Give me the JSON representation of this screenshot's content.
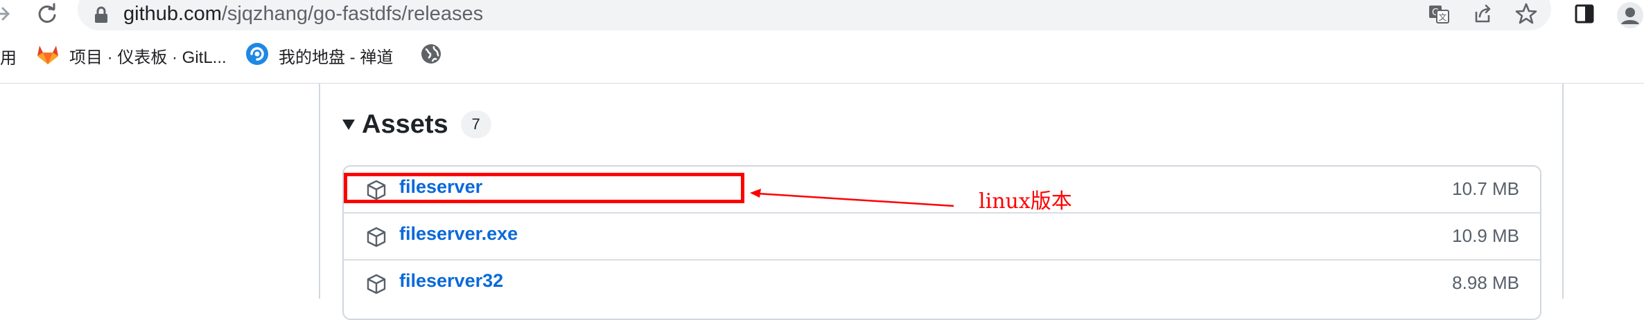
{
  "browser": {
    "url_host": "github.com",
    "url_path": "/sjqzhang/go-fastdfs/releases",
    "bookmarks": {
      "apps_label": "用",
      "items": [
        {
          "label": "项目 · 仪表板 · GitL...",
          "icon": "gitlab-icon"
        },
        {
          "label": "我的地盘 - 禅道",
          "icon": "zentao-icon"
        },
        {
          "label": "",
          "icon": "globe-icon"
        }
      ]
    },
    "icons": [
      "forward-icon",
      "reload-icon",
      "lock-icon",
      "translate-icon",
      "share-icon",
      "star-icon",
      "sidepanel-icon",
      "profile-icon"
    ]
  },
  "assets": {
    "title": "Assets",
    "count": "7",
    "rows": [
      {
        "name": "fileserver",
        "size": "10.7 MB"
      },
      {
        "name": "fileserver.exe",
        "size": "10.9 MB"
      },
      {
        "name": "fileserver32",
        "size": "8.98 MB"
      }
    ]
  },
  "annotation": {
    "label": "linux版本",
    "color": "#ff0000"
  },
  "colors": {
    "link": "#0969da",
    "border": "#d0d7de",
    "muted": "#57606a"
  }
}
